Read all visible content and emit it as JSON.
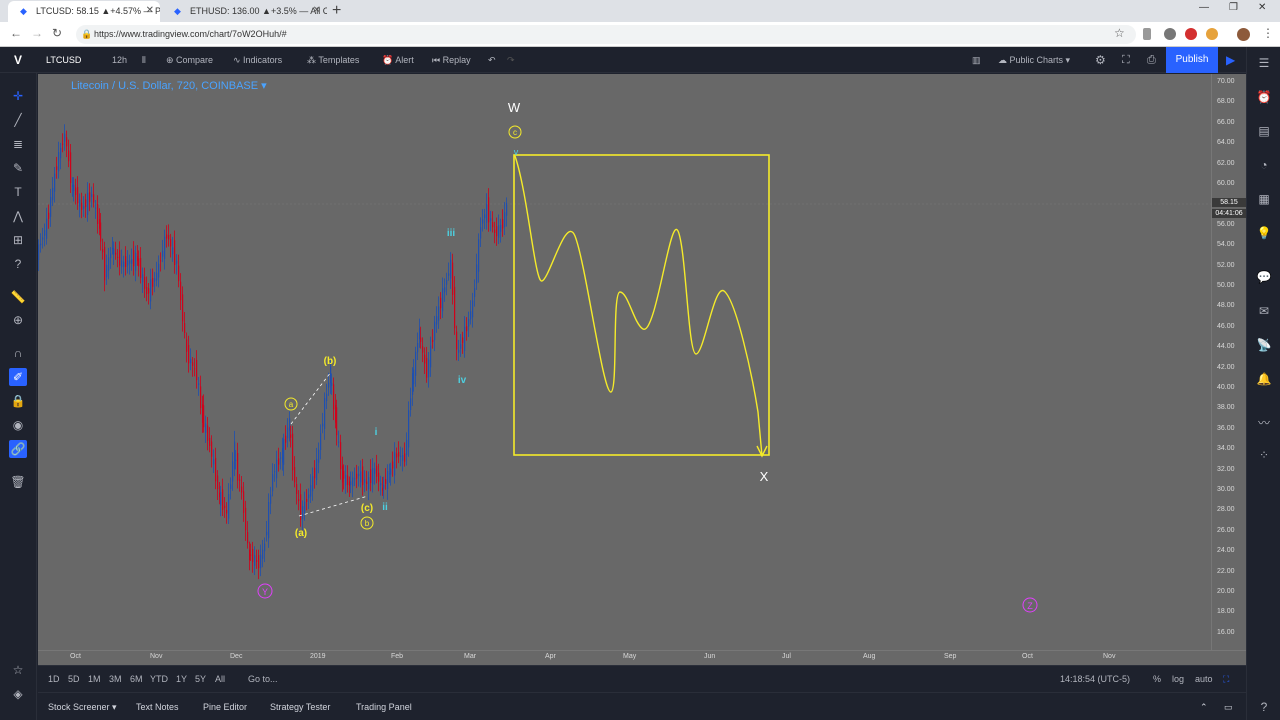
{
  "browser": {
    "tabs": [
      {
        "title": "LTCUSD: 58.15 ▲+4.57% — Publ"
      },
      {
        "title": "ETHUSD: 136.00 ▲+3.5% — All C"
      }
    ],
    "url": "https://www.tradingview.com/chart/7oW2OHuh/#"
  },
  "toolbar": {
    "symbol": "LTCUSD",
    "interval": "12h",
    "compare": "Compare",
    "indicators": "Indicators",
    "templates": "Templates",
    "alert": "Alert",
    "replay": "Replay",
    "public_charts": "Public Charts",
    "publish": "Publish"
  },
  "chart": {
    "title": "Litecoin / U.S. Dollar, 720, COINBASE",
    "last_price": "58.15",
    "countdown": "04:41:06",
    "price_ticks": [
      "70.00",
      "68.00",
      "66.00",
      "64.00",
      "62.00",
      "60.00",
      "58.00",
      "56.00",
      "54.00",
      "52.00",
      "50.00",
      "48.00",
      "46.00",
      "44.00",
      "42.00",
      "40.00",
      "38.00",
      "36.00",
      "34.00",
      "32.00",
      "30.00",
      "28.00",
      "26.00",
      "24.00",
      "22.00",
      "20.00",
      "18.00",
      "16.00"
    ],
    "time_ticks": [
      "Oct",
      "Nov",
      "Dec",
      "2019",
      "Feb",
      "Mar",
      "Apr",
      "May",
      "Jun",
      "Jul",
      "Aug",
      "Sep",
      "Oct",
      "Nov"
    ],
    "annotations": {
      "W": "W",
      "X": "X",
      "c_circle": "c",
      "v": "v",
      "iii": "iii",
      "iv": "iv",
      "i": "i",
      "ii": "ii",
      "b_paren": "(b)",
      "a_paren": "(a)",
      "c_paren": "(c)",
      "a_circle": "a",
      "b_circle": "b",
      "Y": "Y",
      "Z": "Z"
    },
    "colors": {
      "bg": "#686868",
      "up": "#1e4fb0",
      "down": "#d0021b",
      "yellow": "#f5eb2a",
      "cyan": "#4dd0e1",
      "magenta": "#e040fb"
    }
  },
  "range_bar": {
    "ranges": [
      "1D",
      "5D",
      "1M",
      "3M",
      "6M",
      "YTD",
      "1Y",
      "5Y",
      "All"
    ],
    "goto": "Go to...",
    "clock": "14:18:54 (UTC-5)",
    "percent": "%",
    "log": "log",
    "auto": "auto"
  },
  "bottom_tabs": [
    "Stock Screener",
    "Text Notes",
    "Pine Editor",
    "Strategy Tester",
    "Trading Panel"
  ]
}
